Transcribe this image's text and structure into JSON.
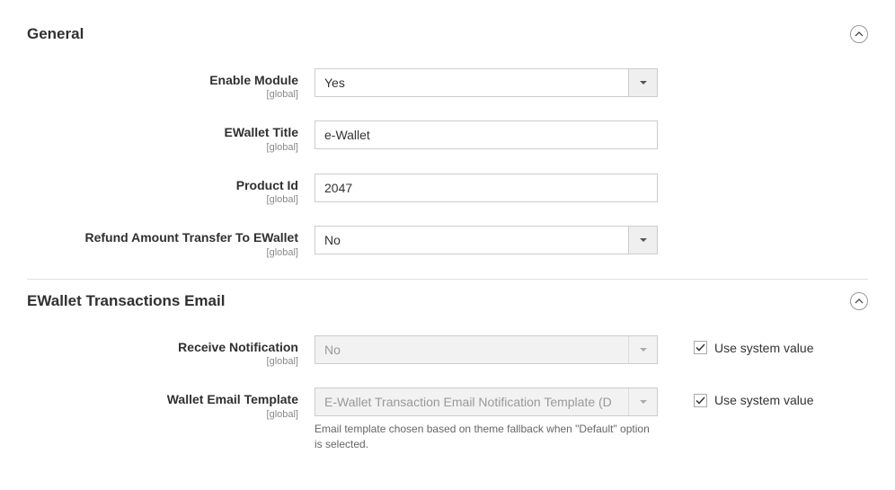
{
  "sections": {
    "general": {
      "title": "General",
      "scope_label": "[global]",
      "fields": {
        "enable_module": {
          "label": "Enable Module",
          "value": "Yes"
        },
        "ewallet_title": {
          "label": "EWallet Title",
          "value": "e-Wallet"
        },
        "product_id": {
          "label": "Product Id",
          "value": "2047"
        },
        "refund_transfer": {
          "label": "Refund Amount Transfer To EWallet",
          "value": "No"
        }
      }
    },
    "transactions_email": {
      "title": "EWallet Transactions Email",
      "scope_label": "[global]",
      "fields": {
        "receive_notification": {
          "label": "Receive Notification",
          "value": "No",
          "use_system_label": "Use system value",
          "use_system_checked": true
        },
        "wallet_email_template": {
          "label": "Wallet Email Template",
          "value": "E-Wallet Transaction Email Notification Template (D",
          "use_system_label": "Use system value",
          "use_system_checked": true,
          "note": "Email template chosen based on theme fallback when \"Default\" option is selected."
        }
      }
    }
  }
}
